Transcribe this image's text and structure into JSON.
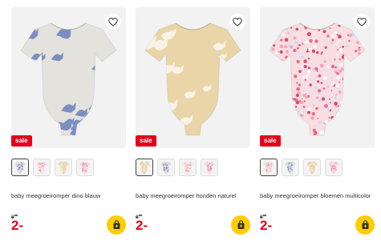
{
  "colors": {
    "sale_red": "#e4001b",
    "cart_yellow": "#ffcd00",
    "image_bg": "#f2f2f2"
  },
  "products": [
    {
      "name": "baby meegroeiromper dino blauw",
      "badge": "sale",
      "old_price_main": "6",
      "old_price_cents": "00",
      "new_price": "2-",
      "garment_color": "#e4e2dc",
      "pattern_color": "#7d8ec2",
      "pattern": "dino",
      "swatches": [
        {
          "name": "grey-dino",
          "base": "#dedcd6",
          "dot": "#7d8ec2",
          "selected": true
        },
        {
          "name": "pink-floral",
          "base": "#f5e0e2",
          "dot": "#e8a0a8",
          "selected": false
        },
        {
          "name": "beige-dog",
          "base": "#e9d6ad",
          "dot": "#f7f1e4",
          "selected": false
        },
        {
          "name": "pink-floral-2",
          "base": "#f7d7df",
          "dot": "#ea8aa4",
          "selected": false
        }
      ]
    },
    {
      "name": "baby meegroeiromper honden naturel",
      "badge": "sale",
      "old_price_main": "6",
      "old_price_cents": "00",
      "new_price": "2-",
      "garment_color": "#ead5a8",
      "pattern_color": "#f8f3e6",
      "pattern": "dog",
      "swatches": [
        {
          "name": "beige-dog",
          "base": "#e9d6ad",
          "dot": "#f7f1e4",
          "selected": true
        },
        {
          "name": "grey-dino",
          "base": "#dedcd6",
          "dot": "#7d8ec2",
          "selected": false
        },
        {
          "name": "pink-floral",
          "base": "#f5e0e2",
          "dot": "#e8a0a8",
          "selected": false
        },
        {
          "name": "pink-floral-2",
          "base": "#f7d7df",
          "dot": "#ea8aa4",
          "selected": false
        }
      ]
    },
    {
      "name": "baby meegroeiromper bloemen multicolor",
      "badge": "sale",
      "old_price_main": "6",
      "old_price_cents": "00",
      "new_price": "2-",
      "garment_color": "#f8dde2",
      "pattern_color": "#e86b8a",
      "pattern": "floral",
      "swatches": [
        {
          "name": "pink-floral",
          "base": "#f5e0e2",
          "dot": "#e8a0a8",
          "selected": true
        },
        {
          "name": "grey-dino",
          "base": "#dedcd6",
          "dot": "#7d8ec2",
          "selected": false
        },
        {
          "name": "beige-dog",
          "base": "#e9d6ad",
          "dot": "#f7f1e4",
          "selected": false
        },
        {
          "name": "pink-floral-2",
          "base": "#f7d7df",
          "dot": "#ea8aa4",
          "selected": false
        }
      ]
    }
  ]
}
